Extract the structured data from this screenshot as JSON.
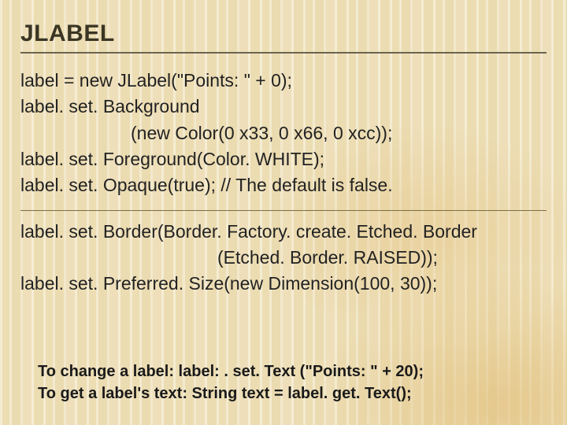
{
  "title": "JLABEL",
  "block1": {
    "l1": "label = new JLabel(\"Points: \" + 0);",
    "l2": "label. set. Background",
    "l3": "(new Color(0 x33, 0 x66, 0 xcc));",
    "l4": "label. set. Foreground(Color. WHITE);",
    "l5": "label. set. Opaque(true); // The default is false."
  },
  "block2": {
    "l1": "label. set. Border(Border. Factory. create. Etched. Border",
    "l2": "(Etched. Border. RAISED));",
    "l3": "label. set. Preferred. Size(new Dimension(100, 30));"
  },
  "footer": {
    "l1": "To change a label: label: . set. Text (\"Points: \" + 20);",
    "l2": "To get a label's text: String text = label. get. Text();"
  }
}
